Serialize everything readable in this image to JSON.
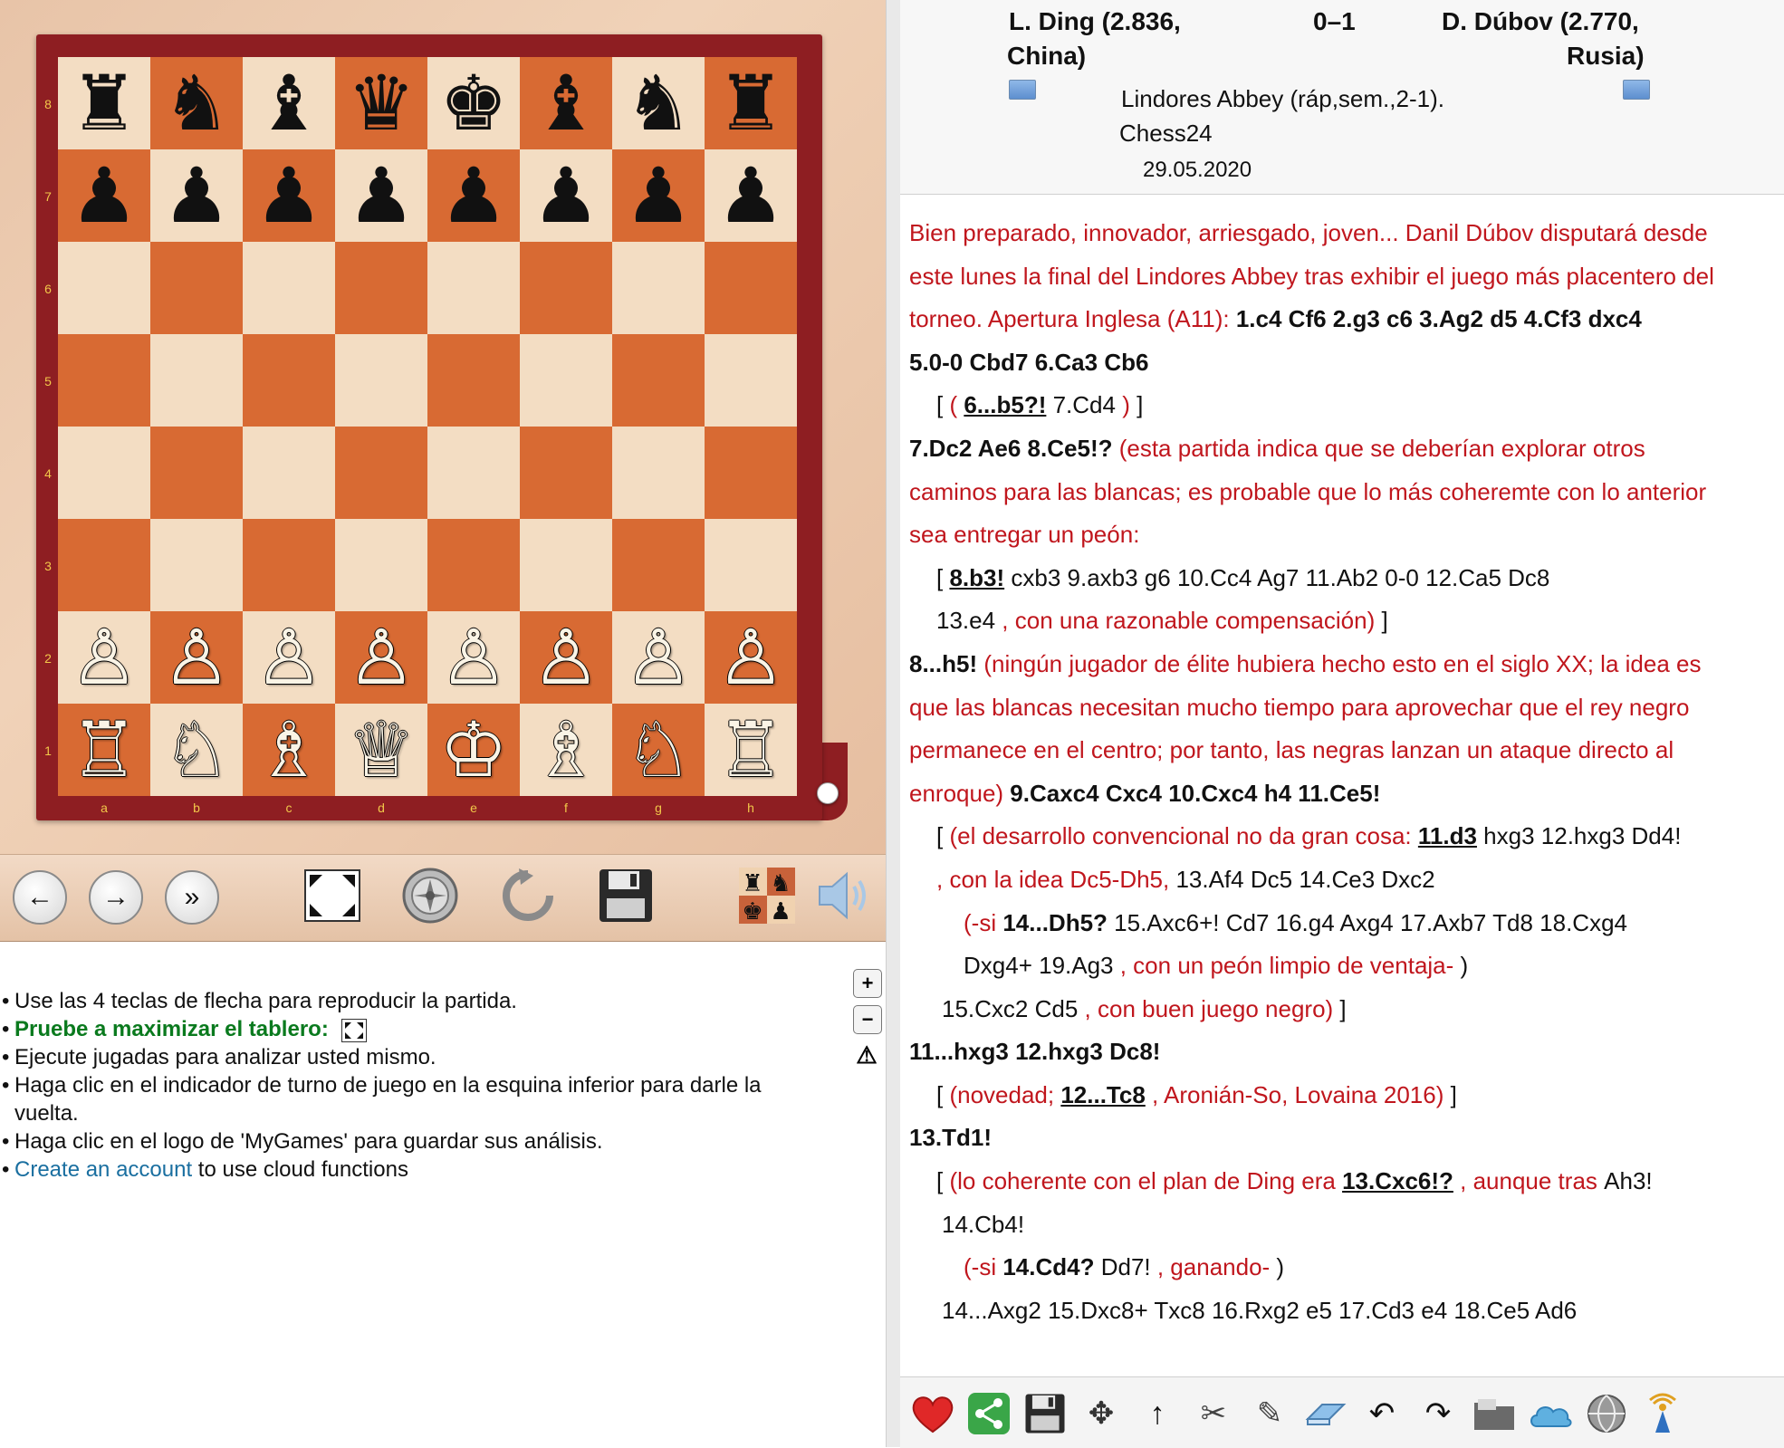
{
  "board": {
    "ranks": [
      "8",
      "7",
      "6",
      "5",
      "4",
      "3",
      "2",
      "1"
    ],
    "files": [
      "a",
      "b",
      "c",
      "d",
      "e",
      "f",
      "g",
      "h"
    ],
    "rows": [
      [
        "♜",
        "♞",
        "♝",
        "♛",
        "♚",
        "♝",
        "♞",
        "♜"
      ],
      [
        "♟",
        "♟",
        "♟",
        "♟",
        "♟",
        "♟",
        "♟",
        "♟"
      ],
      [
        "",
        "",
        "",
        "",
        "",
        "",
        "",
        ""
      ],
      [
        "",
        "",
        "",
        "",
        "",
        "",
        "",
        ""
      ],
      [
        "",
        "",
        "",
        "",
        "",
        "",
        "",
        ""
      ],
      [
        "",
        "",
        "",
        "",
        "",
        "",
        "",
        ""
      ],
      [
        "♙",
        "♙",
        "♙",
        "♙",
        "♙",
        "♙",
        "♙",
        "♙"
      ],
      [
        "♖",
        "♘",
        "♗",
        "♕",
        "♔",
        "♗",
        "♘",
        "♖"
      ]
    ],
    "light_color": "#f3ddc3",
    "dark_color": "#d86a33",
    "frame_color": "#8e1e22"
  },
  "controls": {
    "back_icon": "←",
    "forward_icon": "→",
    "fast_forward_icon": "»"
  },
  "info": {
    "items": [
      "Use las 4 teclas de flecha para reproducir la partida.",
      "Pruebe a maximizar el tablero:",
      "Ejecute jugadas para analizar usted mismo.",
      "Haga clic en el indicador de turno de juego en la esquina inferior para darle la vuelta.",
      "Haga clic en el logo de 'MyGames' para guardar sus análisis."
    ],
    "create_link": "Create an account",
    "create_rest": " to use cloud functions"
  },
  "header": {
    "white_player": "L. Ding (2.836,",
    "white_country": "China)",
    "result": "0–1",
    "black_player": "D. Dúbov (2.770,",
    "black_country": "Rusia)",
    "event": "Lindores Abbey (ráp,sem.,2-1).",
    "site": "Chess24",
    "date": "29.05.2020"
  },
  "notation": {
    "l1": "Bien preparado, innovador, arriesgado, joven... Danil Dúbov disputará desde",
    "l2": "este lunes la final del Lindores Abbey tras exhibir el juego más placentero del",
    "l3a": "torneo. Apertura Inglesa (A11): ",
    "l3b": "1.c4 Cf6 2.g3 c6 3.Ag2 d5 4.Cf3 dxc4",
    "l4": "5.0-0 Cbd7 6.Ca3 Cb6",
    "l5a": "[ ",
    "l5b": "( ",
    "l5c": "6...b5?!",
    "l5d": " 7.Cd4 ",
    "l5e": ")",
    "l5f": " ]",
    "l6a": "7.Dc2 Ae6 8.Ce5!?",
    "l6b": " (esta partida indica que se deberían explorar otros",
    "l7": "caminos para las blancas; es probable que lo más coheremte con lo anterior",
    "l8": "sea entregar un peón:",
    "l9a": "[ ",
    "l9b": "8.b3!",
    "l9c": " cxb3 9.axb3 g6 10.Cc4 Ag7 11.Ab2 0-0 12.Ca5 Dc8",
    "l10a": "13.e4 ",
    "l10b": ", con una razonable compensación)",
    "l10c": " ]",
    "l11a": "8...h5!",
    "l11b": " (ningún jugador de élite hubiera hecho esto en el siglo XX; la idea es",
    "l12": "que las blancas necesitan mucho tiempo para aprovechar que el rey negro",
    "l13": "permanece en el centro; por tanto, las negras lanzan un ataque directo al",
    "l14a": "enroque)",
    "l14b": " 9.Caxc4 Cxc4 10.Cxc4 h4 11.Ce5!",
    "l15a": "[ ",
    "l15b": "(el desarrollo convencional no da gran cosa: ",
    "l15c": "11.d3",
    "l15d": " hxg3 12.hxg3 Dd4!",
    "l16a": ", con la idea Dc5-Dh5,",
    "l16b": " 13.Af4 Dc5 14.Ce3 Dxc2",
    "l17a": "(-si ",
    "l17b": "14...Dh5?",
    "l17c": " 15.Axc6+! Cd7 16.g4 Axg4 17.Axb7 Td8 18.Cxg4",
    "l18a": "Dxg4+ 19.Ag3 ",
    "l18b": ", con un peón limpio de ventaja-",
    "l18c": " )",
    "l19a": "15.Cxc2 Cd5 ",
    "l19b": ", con buen juego negro)",
    "l19c": " ]",
    "l20": "11...hxg3 12.hxg3 Dc8!",
    "l21a": "[ ",
    "l21b": "(novedad; ",
    "l21c": "12...Tc8",
    "l21d": " , Aronián-So, Lovaina 2016)",
    "l21e": " ]",
    "l22": "13.Td1!",
    "l23a": "[ ",
    "l23b": "(lo coherente con el plan de Ding era ",
    "l23c": "13.Cxc6!?",
    "l23d": " , aunque tras ",
    "l23e": " Ah3!",
    "l24": "14.Cb4!",
    "l25a": "(-si ",
    "l25b": "14.Cd4?",
    "l25c": " Dd7!",
    "l25d": " , ganando-",
    "l25e": " )",
    "l26": "14...Axg2 15.Dxc8+ Txc8 16.Rxg2 e5 17.Cd3 e4 18.Ce5 Ad6"
  },
  "toolbar_icons": [
    "heart-icon",
    "share-icon",
    "save-icon",
    "move-icon",
    "up-arrow-icon",
    "cut-icon",
    "pen-icon",
    "eraser-icon",
    "undo-icon",
    "redo-icon",
    "folder-icon",
    "cloud-icon",
    "globe-icon",
    "signal-icon"
  ]
}
